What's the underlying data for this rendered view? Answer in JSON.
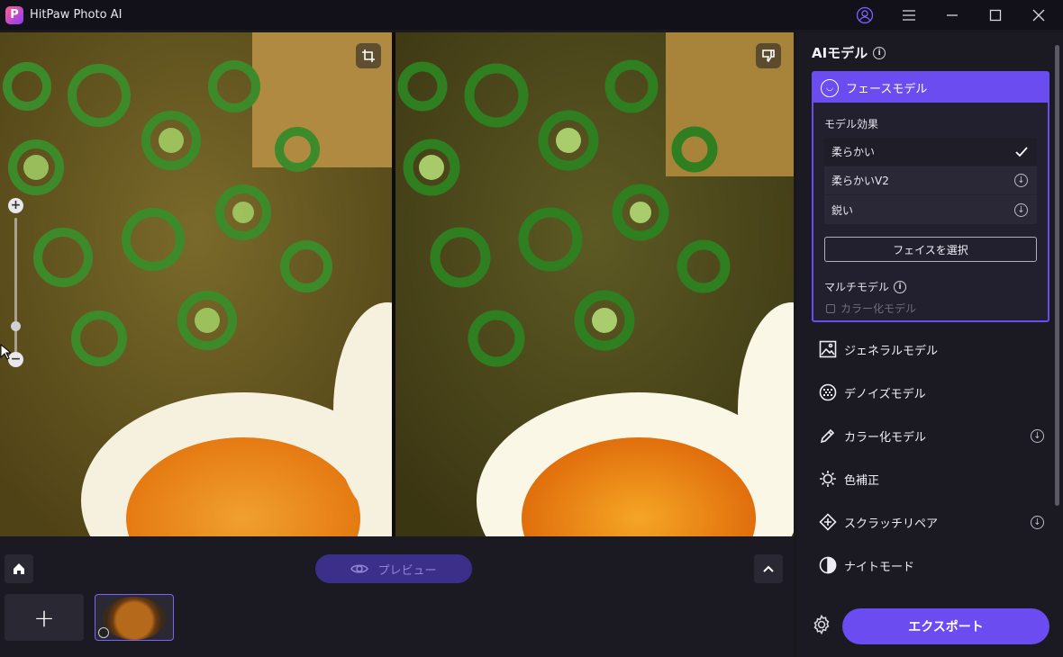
{
  "titlebar": {
    "logo_letter": "P",
    "title": "HitPaw Photo AI"
  },
  "sidebar": {
    "title": "AIモデル",
    "face_model": {
      "label": "フェースモデル",
      "effect_label": "モデル効果",
      "options": [
        {
          "label": "柔らかい",
          "state": "selected"
        },
        {
          "label": "柔らかいV2",
          "state": "download"
        },
        {
          "label": "鋭い",
          "state": "download"
        }
      ],
      "select_face_button": "フェイスを選択",
      "multi_model_label": "マルチモデル",
      "multi_model_option": "カラー化モデル"
    },
    "models": [
      {
        "label": "ジェネラルモデル",
        "icon": "image-icon",
        "download": false
      },
      {
        "label": "デノイズモデル",
        "icon": "denoise-icon",
        "download": false
      },
      {
        "label": "カラー化モデル",
        "icon": "colorize-icon",
        "download": true
      },
      {
        "label": "色補正",
        "icon": "sun-icon",
        "download": false
      },
      {
        "label": "スクラッチリペア",
        "icon": "scratch-icon",
        "download": true
      },
      {
        "label": "ナイトモード",
        "icon": "half-circle-icon",
        "download": false
      }
    ],
    "export_button": "エクスポート"
  },
  "bottom": {
    "preview_button": "プレビュー",
    "add_symbol": "+"
  },
  "zoom": {
    "plus": "+",
    "minus": "−",
    "level_fraction": 0.2
  },
  "colors": {
    "accent": "#6a4cf0",
    "background": "#19181f",
    "panel": "#1b1a22"
  }
}
